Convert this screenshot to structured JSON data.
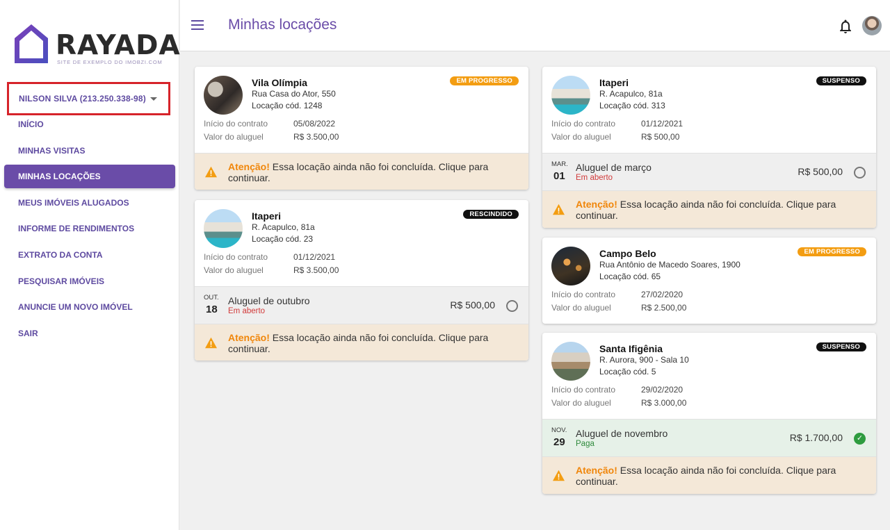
{
  "brand": {
    "name": "RAYADA",
    "tagline": "SITE DE EXEMPLO DO IMOBZI.COM",
    "color": "#6a4ca8"
  },
  "user": {
    "label": "NILSON SILVA (213.250.338-98)"
  },
  "nav": [
    {
      "label": "INÍCIO",
      "active": false
    },
    {
      "label": "MINHAS VISITAS",
      "active": false
    },
    {
      "label": "MINHAS LOCAÇÕES",
      "active": true
    },
    {
      "label": "MEUS IMÓVEIS ALUGADOS",
      "active": false
    },
    {
      "label": "INFORME DE RENDIMENTOS",
      "active": false
    },
    {
      "label": "EXTRATO DA CONTA",
      "active": false
    },
    {
      "label": "PESQUISAR IMÓVEIS",
      "active": false
    },
    {
      "label": "ANUNCIE UM NOVO IMÓVEL",
      "active": false
    },
    {
      "label": "SAIR",
      "active": false
    }
  ],
  "header": {
    "title": "Minhas locações",
    "menu_icon": "hamburger-icon",
    "notification_icon": "bell-icon"
  },
  "labels": {
    "contract_start": "Início do contrato",
    "rent_value": "Valor do aluguel",
    "alert_strong": "Atenção!",
    "alert_text": " Essa locação ainda não foi concluída. Clique para continuar."
  },
  "cards": [
    {
      "title": "Vila Olímpia",
      "address": "Rua Casa do Ator, 550",
      "code": "Locação cód. 1248",
      "status": "EM PROGRESSO",
      "status_color": "#f39d12",
      "contract_start": "05/08/2022",
      "rent_value": "R$ 3.500,00"
    },
    {
      "title": "Itaperi",
      "address": "R. Acapulco, 81a",
      "code": "Locação cód. 23",
      "status": "RESCINDIDO",
      "status_color": "#111111",
      "contract_start": "01/12/2021",
      "rent_value": "R$ 3.500,00",
      "rent": {
        "month": "OUT.",
        "day": "18",
        "title": "Aluguel de outubro",
        "status": "Em aberto",
        "value": "R$ 500,00"
      }
    },
    {
      "title": "Itaperi",
      "address": "R. Acapulco, 81a",
      "code": "Locação cód. 313",
      "status": "SUSPENSO",
      "status_color": "#111111",
      "contract_start": "01/12/2021",
      "rent_value": "R$ 500,00",
      "rent": {
        "month": "MAR.",
        "day": "01",
        "title": "Aluguel de março",
        "status": "Em aberto",
        "value": "R$ 500,00"
      }
    },
    {
      "title": "Campo Belo",
      "address": "Rua Antônio de Macedo Soares, 1900",
      "code": "Locação cód. 65",
      "status": "EM PROGRESSO",
      "status_color": "#f39d12",
      "contract_start": "27/02/2020",
      "rent_value": "R$ 2.500,00"
    },
    {
      "title": "Santa Ifigênia",
      "address": "R. Aurora, 900 - Sala 10",
      "code": "Locação cód. 5",
      "status": "SUSPENSO",
      "status_color": "#111111",
      "contract_start": "29/02/2020",
      "rent_value": "R$ 3.000,00",
      "rent": {
        "month": "NOV.",
        "day": "29",
        "title": "Aluguel de novembro",
        "status": "Paga",
        "value": "R$ 1.700,00"
      }
    }
  ]
}
